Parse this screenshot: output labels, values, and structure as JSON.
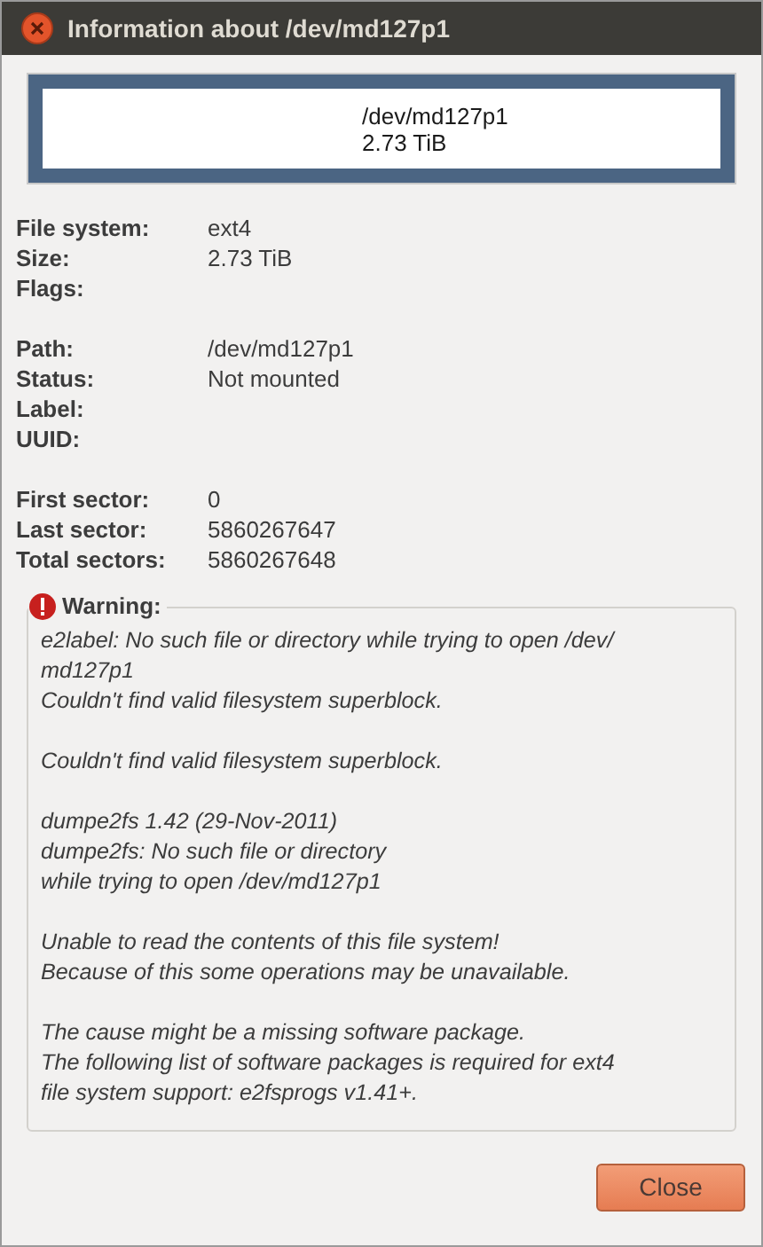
{
  "window": {
    "title": "Information about /dev/md127p1"
  },
  "partition": {
    "path": "/dev/md127p1",
    "size": "2.73 TiB"
  },
  "info_groups": [
    [
      {
        "label": "File system:",
        "value": "ext4"
      },
      {
        "label": "Size:",
        "value": "2.73 TiB"
      },
      {
        "label": "Flags:"
      }
    ],
    [
      {
        "label": "Path:",
        "value": "/dev/md127p1"
      },
      {
        "label": "Status:",
        "value": "Not mounted"
      },
      {
        "label": "Label:"
      },
      {
        "label": "UUID:"
      }
    ],
    [
      {
        "label": "First sector:",
        "value": "0"
      },
      {
        "label": "Last sector:",
        "value": "5860267647"
      },
      {
        "label": "Total sectors:",
        "value": "5860267648"
      }
    ]
  ],
  "warning": {
    "title": "Warning:",
    "paragraphs": [
      [
        "e2label: No such file or directory while trying to open /dev/",
        "md127p1",
        "Couldn't find valid filesystem superblock."
      ],
      [
        "Couldn't find valid filesystem superblock."
      ],
      [
        "dumpe2fs 1.42 (29-Nov-2011)",
        "dumpe2fs: No such file or directory",
        "while trying to open /dev/md127p1"
      ],
      [
        "Unable to read the contents of this file system!",
        "Because of this some operations may be unavailable."
      ],
      [
        "The cause might be a missing software package.",
        "The following list of software packages is required for ext4",
        "file system support:  e2fsprogs v1.41+."
      ]
    ]
  },
  "buttons": [
    "Close"
  ]
}
